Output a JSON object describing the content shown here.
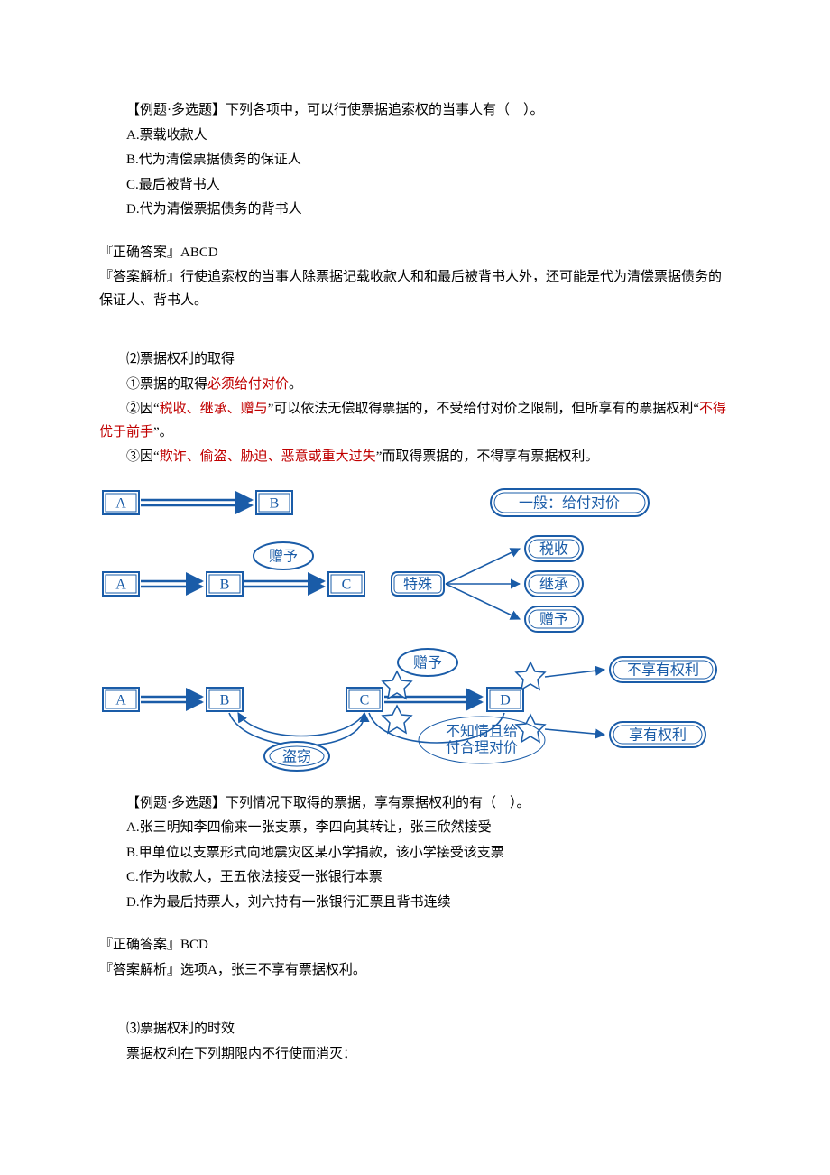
{
  "q1": {
    "header": "【例题·多选题】下列各项中，可以行使票据追索权的当事人有（　）。",
    "opts": {
      "A": "A.票载收款人",
      "B": "B.代为清偿票据债务的保证人",
      "C": "C.最后被背书人",
      "D": "D.代为清偿票据债务的背书人"
    },
    "ans_label": "『正确答案』",
    "ans": "ABCD",
    "exp_label": "『答案解析』",
    "exp": "行使追索权的当事人除票据记载收款人和和最后被背书人外，还可能是代为清偿票据债务的保证人、背书人。"
  },
  "section2": {
    "title": "⑵票据权利的取得",
    "p1a": "①票据的取得",
    "p1b": "必须给付对价",
    "p1c": "。",
    "p2a": "②因“",
    "p2b": "税收、继承、赠与",
    "p2c": "”可以依法无偿取得票据的，不受给付对价之限制，但所享有的票据权利“",
    "p2d": "不得优于前手",
    "p2e": "”。",
    "p3a": "③因“",
    "p3b": "欺诈、偷盗、胁迫、恶意或重大过失",
    "p3c": "”而取得票据的，不得享有票据权利。"
  },
  "diagram": {
    "A": "A",
    "B": "B",
    "C": "C",
    "D": "D",
    "gift": "赠予",
    "special": "特殊",
    "general": "一般：给付对价",
    "tax": "税收",
    "inherit": "继承",
    "gift2": "赠予",
    "theft": "盗窃",
    "noRight": "不享有权利",
    "hasRight": "享有权利",
    "unaware": "不知情且给",
    "unaware2": "付合理对价"
  },
  "q2": {
    "header": "【例题·多选题】下列情况下取得的票据，享有票据权利的有（　）。",
    "opts": {
      "A": "A.张三明知李四偷来一张支票，李四向其转让，张三欣然接受",
      "B": "B.甲单位以支票形式向地震灾区某小学捐款，该小学接受该支票",
      "C": "C.作为收款人，王五依法接受一张银行本票",
      "D": "D.作为最后持票人，刘六持有一张银行汇票且背书连续"
    },
    "ans_label": "『正确答案』",
    "ans": "BCD",
    "exp_label": "『答案解析』",
    "exp": "选项A，张三不享有票据权利。"
  },
  "section3": {
    "title": "⑶票据权利的时效",
    "body": "票据权利在下列期限内不行使而消灭："
  }
}
